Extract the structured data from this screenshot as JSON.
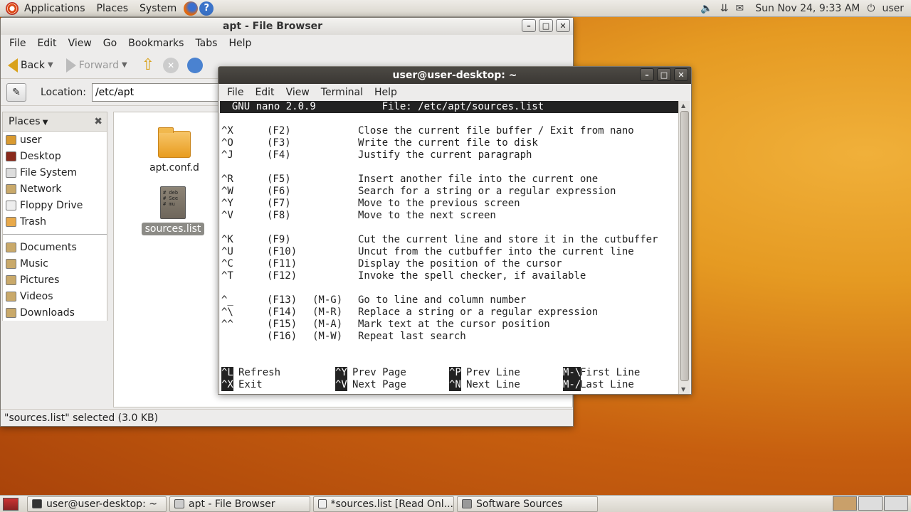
{
  "top_panel": {
    "menus": [
      "Applications",
      "Places",
      "System"
    ],
    "clock": "Sun Nov 24,  9:33 AM",
    "user": "user"
  },
  "file_browser": {
    "title": "apt - File Browser",
    "menus": [
      "File",
      "Edit",
      "View",
      "Go",
      "Bookmarks",
      "Tabs",
      "Help"
    ],
    "toolbar": {
      "back": "Back",
      "forward": "Forward"
    },
    "location_label": "Location:",
    "location_value": "/etc/apt",
    "sidebar": {
      "header": "Places",
      "items": [
        "user",
        "Desktop",
        "File System",
        "Network",
        "Floppy Drive",
        "Trash"
      ],
      "bookmarks": [
        "Documents",
        "Music",
        "Pictures",
        "Videos",
        "Downloads"
      ]
    },
    "files": [
      {
        "name": "apt.conf.d",
        "type": "folder"
      },
      {
        "name": "sources.list",
        "type": "text",
        "preview": "# deb\n# See\n# mu"
      }
    ],
    "status": "\"sources.list\" selected (3.0 KB)"
  },
  "terminal": {
    "title": "user@user-desktop: ~",
    "menus": [
      "File",
      "Edit",
      "View",
      "Terminal",
      "Help"
    ],
    "nano_header": "  GNU nano 2.0.9           File: /etc/apt/sources.list",
    "help_rows": [
      {
        "k": "^X",
        "f": "(F2)",
        "m": "",
        "d": "Close the current file buffer / Exit from nano"
      },
      {
        "k": "^O",
        "f": "(F3)",
        "m": "",
        "d": "Write the current file to disk"
      },
      {
        "k": "^J",
        "f": "(F4)",
        "m": "",
        "d": "Justify the current paragraph"
      },
      {
        "k": "",
        "f": "",
        "m": "",
        "d": ""
      },
      {
        "k": "^R",
        "f": "(F5)",
        "m": "",
        "d": "Insert another file into the current one"
      },
      {
        "k": "^W",
        "f": "(F6)",
        "m": "",
        "d": "Search for a string or a regular expression"
      },
      {
        "k": "^Y",
        "f": "(F7)",
        "m": "",
        "d": "Move to the previous screen"
      },
      {
        "k": "^V",
        "f": "(F8)",
        "m": "",
        "d": "Move to the next screen"
      },
      {
        "k": "",
        "f": "",
        "m": "",
        "d": ""
      },
      {
        "k": "^K",
        "f": "(F9)",
        "m": "",
        "d": "Cut the current line and store it in the cutbuffer"
      },
      {
        "k": "^U",
        "f": "(F10)",
        "m": "",
        "d": "Uncut from the cutbuffer into the current line"
      },
      {
        "k": "^C",
        "f": "(F11)",
        "m": "",
        "d": "Display the position of the cursor"
      },
      {
        "k": "^T",
        "f": "(F12)",
        "m": "",
        "d": "Invoke the spell checker, if available"
      },
      {
        "k": "",
        "f": "",
        "m": "",
        "d": ""
      },
      {
        "k": "^_",
        "f": "(F13)",
        "m": "(M-G)",
        "d": "Go to line and column number"
      },
      {
        "k": "^\\",
        "f": "(F14)",
        "m": "(M-R)",
        "d": "Replace a string or a regular expression"
      },
      {
        "k": "^^",
        "f": "(F15)",
        "m": "(M-A)",
        "d": "Mark text at the cursor position"
      },
      {
        "k": "",
        "f": "(F16)",
        "m": "(M-W)",
        "d": "Repeat last search"
      }
    ],
    "shortcuts": [
      [
        {
          "k": "^L",
          "l": "Refresh"
        },
        {
          "k": "^Y",
          "l": "Prev Page"
        },
        {
          "k": "^P",
          "l": "Prev Line"
        },
        {
          "k": "M-\\",
          "l": "First Line"
        }
      ],
      [
        {
          "k": "^X",
          "l": "Exit"
        },
        {
          "k": "^V",
          "l": "Next Page"
        },
        {
          "k": "^N",
          "l": "Next Line"
        },
        {
          "k": "M-/",
          "l": "Last Line"
        }
      ]
    ]
  },
  "taskbar": {
    "tasks": [
      "user@user-desktop: ~",
      "apt - File Browser",
      "*sources.list [Read Onl...",
      "Software Sources"
    ]
  },
  "colors": {
    "desktop": "#e59a22",
    "terminal_title": "#3a3733",
    "selection": "#8c8b86"
  }
}
